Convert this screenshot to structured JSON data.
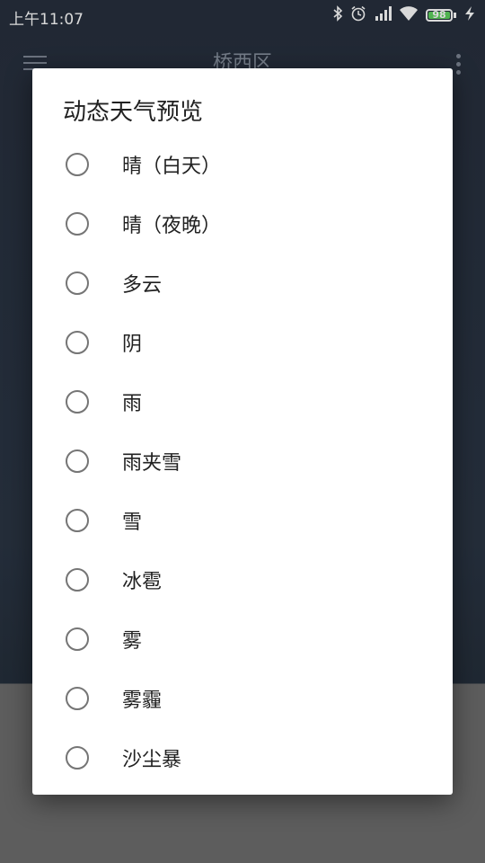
{
  "status_bar": {
    "time": "上午11:07",
    "battery_level": "98",
    "icons": [
      "bluetooth-icon",
      "alarm-icon",
      "signal-icon",
      "wifi-icon",
      "battery-icon",
      "charging-icon"
    ]
  },
  "toolbar": {
    "title": "桥西区"
  },
  "dialog": {
    "title": "动态天气预览",
    "options": [
      {
        "label": "晴（白天）",
        "selected": false
      },
      {
        "label": "晴（夜晚）",
        "selected": false
      },
      {
        "label": "多云",
        "selected": false
      },
      {
        "label": "阴",
        "selected": false
      },
      {
        "label": "雨",
        "selected": false
      },
      {
        "label": "雨夹雪",
        "selected": false
      },
      {
        "label": "雪",
        "selected": false
      },
      {
        "label": "冰雹",
        "selected": false
      },
      {
        "label": "雾",
        "selected": false
      },
      {
        "label": "雾霾",
        "selected": false
      },
      {
        "label": "沙尘暴",
        "selected": false
      }
    ]
  },
  "colors": {
    "radio_outline": "#757575",
    "background": "#2a3341",
    "dialog": "#ffffff"
  }
}
